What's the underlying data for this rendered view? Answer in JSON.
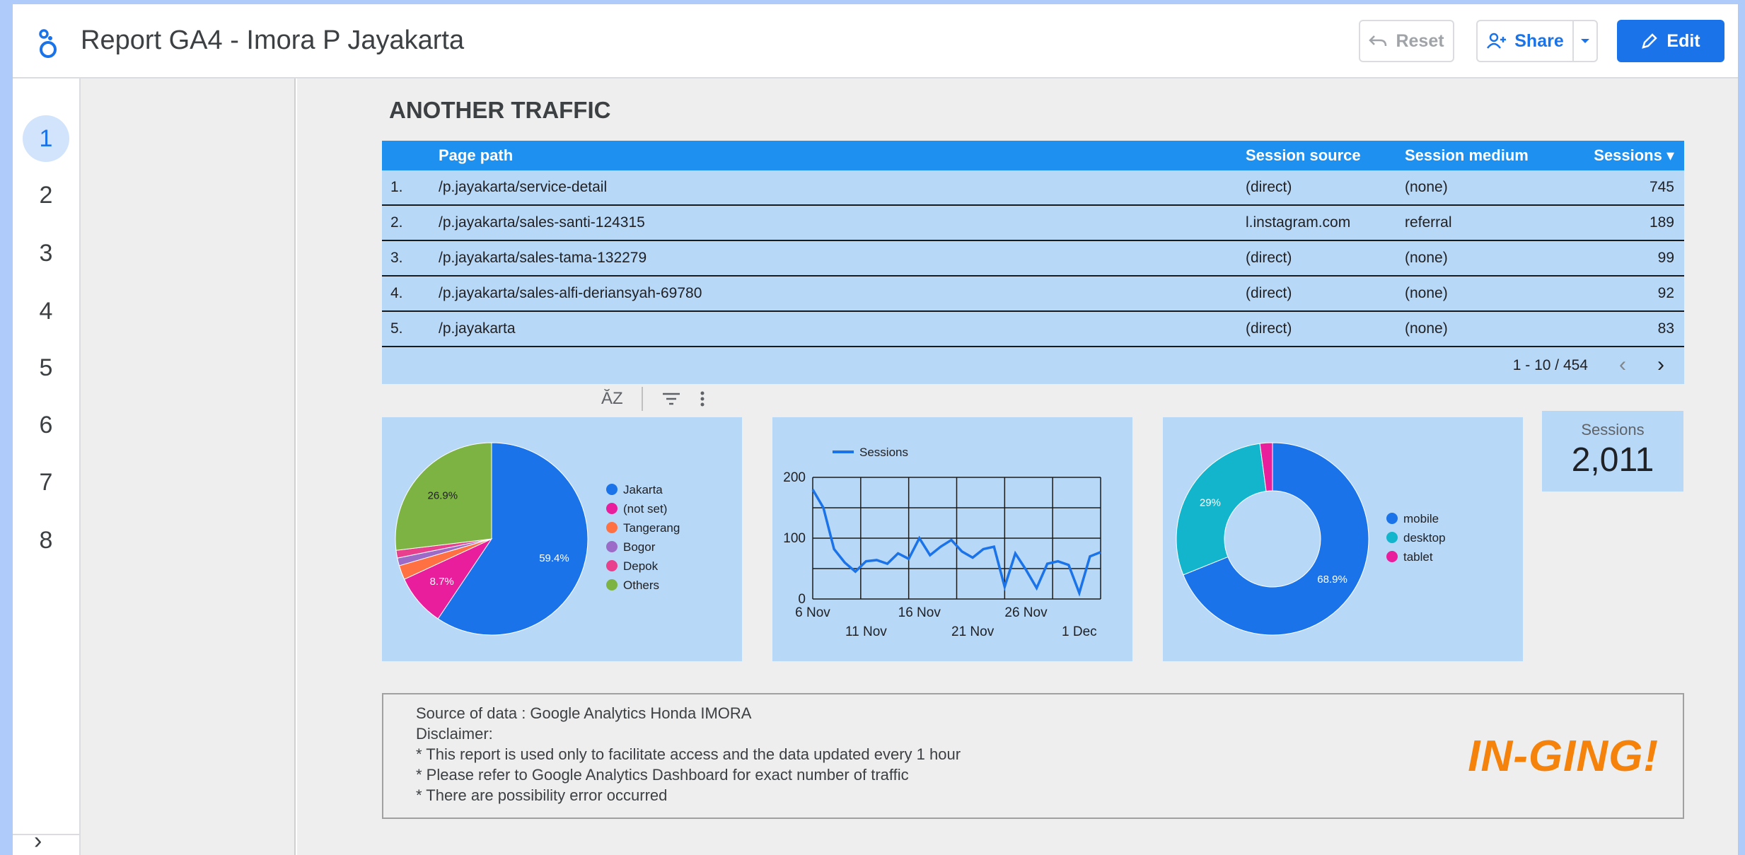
{
  "app": {
    "title": "Report GA4 - Imora P Jayakarta"
  },
  "toolbar": {
    "reset_label": "Reset",
    "share_label": "Share",
    "edit_label": "Edit"
  },
  "sidebar": {
    "pages": [
      "1",
      "2",
      "3",
      "4",
      "5",
      "6",
      "7",
      "8"
    ],
    "active_page": "1"
  },
  "section": {
    "title": "ANOTHER TRAFFIC"
  },
  "table": {
    "headers": {
      "num": "",
      "page_path": "Page path",
      "session_source": "Session source",
      "session_medium": "Session medium",
      "sessions": "Sessions ▾"
    },
    "rows": [
      {
        "num": "1.",
        "path": "/p.jayakarta/service-detail",
        "source": "(direct)",
        "medium": "(none)",
        "sessions": "745"
      },
      {
        "num": "2.",
        "path": "/p.jayakarta/sales-santi-124315",
        "source": "l.instagram.com",
        "medium": "referral",
        "sessions": "189"
      },
      {
        "num": "3.",
        "path": "/p.jayakarta/sales-tama-132279",
        "source": "(direct)",
        "medium": "(none)",
        "sessions": "99"
      },
      {
        "num": "4.",
        "path": "/p.jayakarta/sales-alfi-deriansyah-69780",
        "source": "(direct)",
        "medium": "(none)",
        "sessions": "92"
      },
      {
        "num": "5.",
        "path": "/p.jayakarta",
        "source": "(direct)",
        "medium": "(none)",
        "sessions": "83"
      }
    ],
    "pagination": "1 - 10 / 454"
  },
  "chart_data": [
    {
      "type": "pie",
      "labels": [
        "Jakarta",
        "(not set)",
        "Tangerang",
        "Bogor",
        "Depok",
        "Others"
      ],
      "values": [
        59.4,
        8.7,
        2.4,
        1.3,
        1.3,
        26.9
      ],
      "colors": [
        "#1a73e8",
        "#e91e9c",
        "#ff7043",
        "#9c6bc8",
        "#e8408c",
        "#7cb342"
      ],
      "data_labels": [
        "59.4%",
        "8.7%",
        "",
        "",
        "",
        "26.9%"
      ]
    },
    {
      "type": "line",
      "series": [
        {
          "name": "Sessions",
          "values": [
            180,
            150,
            82,
            60,
            45,
            62,
            64,
            58,
            75,
            66,
            100,
            72,
            86,
            97,
            78,
            68,
            82,
            86,
            20,
            75,
            48,
            18,
            58,
            62,
            56,
            10,
            70,
            77
          ]
        }
      ],
      "x_tick_labels_top": [
        "6 Nov",
        "16 Nov",
        "26 Nov"
      ],
      "x_tick_labels_bottom": [
        "11 Nov",
        "21 Nov",
        "1 Dec"
      ],
      "y_ticks": [
        "0",
        "100",
        "200"
      ],
      "ylim": [
        0,
        200
      ],
      "color": "#1a73e8"
    },
    {
      "type": "pie",
      "donut": true,
      "labels": [
        "mobile",
        "desktop",
        "tablet"
      ],
      "values": [
        68.9,
        29,
        2.1
      ],
      "colors": [
        "#1a73e8",
        "#12b5cb",
        "#e91e9c"
      ],
      "data_labels": [
        "68.9%",
        "29%",
        ""
      ]
    }
  ],
  "scorecard": {
    "label": "Sessions",
    "value": "2,011"
  },
  "footer": {
    "lines": [
      "Source of data : Google Analytics Honda IMORA",
      "Disclaimer:",
      "* This report is used only to facilitate access and the data updated every 1 hour",
      "* Please refer to Google Analytics Dashboard for exact number of traffic",
      "* There are possibility error occurred"
    ],
    "brand": "IN-GING!"
  }
}
